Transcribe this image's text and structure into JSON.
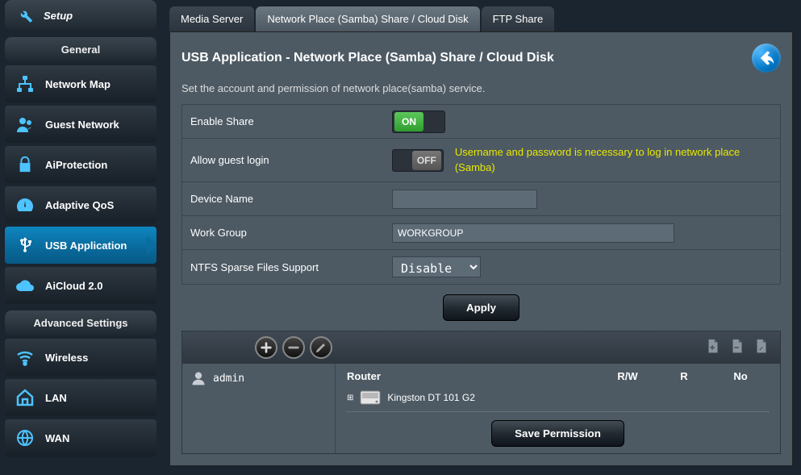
{
  "sidebar": {
    "setup_label": "Setup",
    "general_header": "General",
    "advanced_header": "Advanced Settings",
    "general_items": [
      {
        "label": "Network Map"
      },
      {
        "label": "Guest Network"
      },
      {
        "label": "AiProtection"
      },
      {
        "label": "Adaptive QoS"
      },
      {
        "label": "USB Application"
      },
      {
        "label": "AiCloud 2.0"
      }
    ],
    "advanced_items": [
      {
        "label": "Wireless"
      },
      {
        "label": "LAN"
      },
      {
        "label": "WAN"
      }
    ]
  },
  "tabs": {
    "media": "Media Server",
    "samba": "Network Place (Samba) Share / Cloud Disk",
    "ftp": "FTP Share"
  },
  "panel": {
    "title": "USB Application - Network Place (Samba) Share / Cloud Disk",
    "desc": "Set the account and permission of network place(samba) service.",
    "enable_share_label": "Enable Share",
    "enable_share_state": "ON",
    "allow_guest_label": "Allow guest login",
    "allow_guest_state": "OFF",
    "allow_guest_hint": "Username and password is necessary to log in network place (Samba)",
    "device_name_label": "Device Name",
    "device_name_value": "",
    "workgroup_label": "Work Group",
    "workgroup_value": "WORKGROUP",
    "ntfs_label": "NTFS Sparse Files Support",
    "ntfs_value": "Disable",
    "apply_label": "Apply"
  },
  "perm": {
    "user": "admin",
    "col_device": "Router",
    "col_rw": "R/W",
    "col_r": "R",
    "col_no": "No",
    "device_name": "Kingston DT 101 G2",
    "save_label": "Save Permission"
  }
}
